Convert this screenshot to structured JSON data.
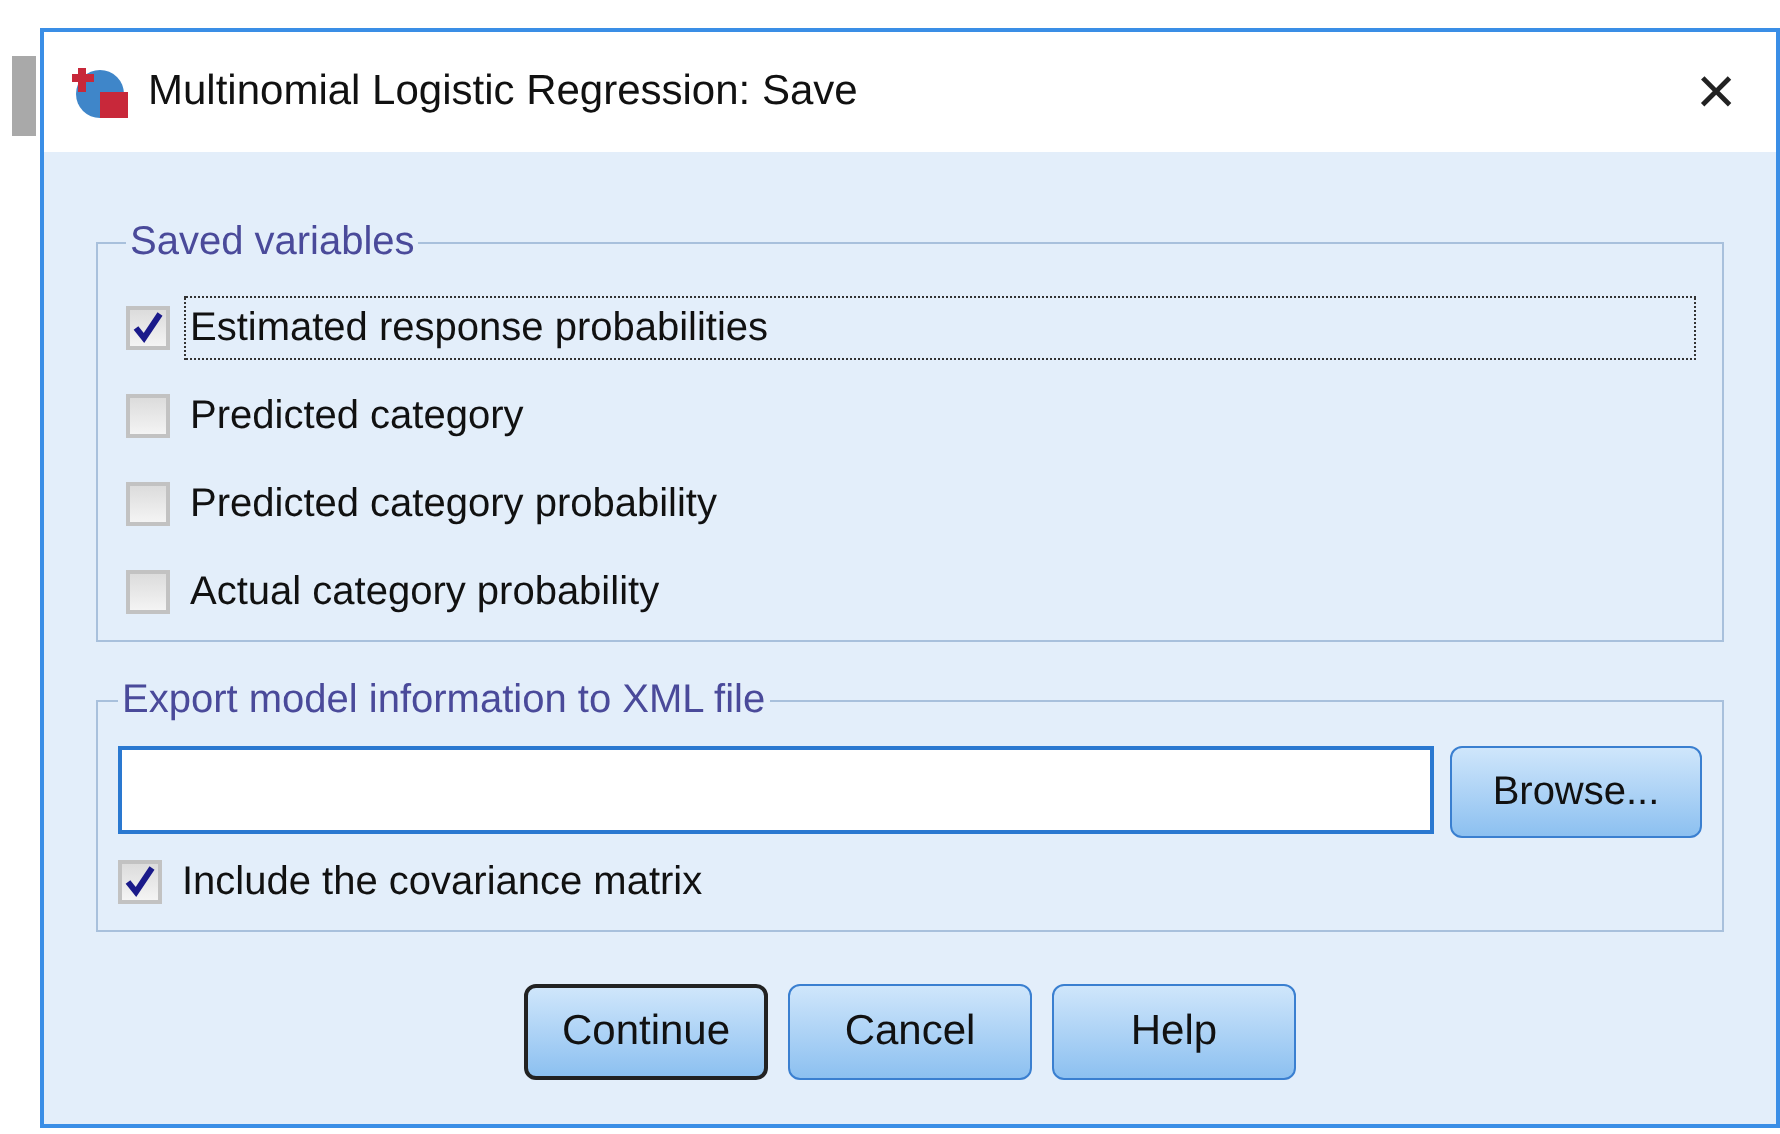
{
  "window": {
    "title": "Multinomial Logistic Regression: Save",
    "close": "×"
  },
  "saved_variables": {
    "title": "Saved variables",
    "checkboxes": [
      {
        "label": "Estimated response probabilities",
        "checked": true,
        "focused": true
      },
      {
        "label": "Predicted category",
        "checked": false,
        "focused": false
      },
      {
        "label": "Predicted category probability",
        "checked": false,
        "focused": false
      },
      {
        "label": "Actual category probability",
        "checked": false,
        "focused": false
      }
    ]
  },
  "export": {
    "title": "Export model information to XML file",
    "browse": "Browse...",
    "checkbox": {
      "label": "Include the covariance matrix",
      "checked": true,
      "focused": false
    }
  },
  "buttons": [
    {
      "label": "Continue",
      "default": true
    },
    {
      "label": "Cancel",
      "default": false
    },
    {
      "label": "Help",
      "default": false
    }
  ]
}
